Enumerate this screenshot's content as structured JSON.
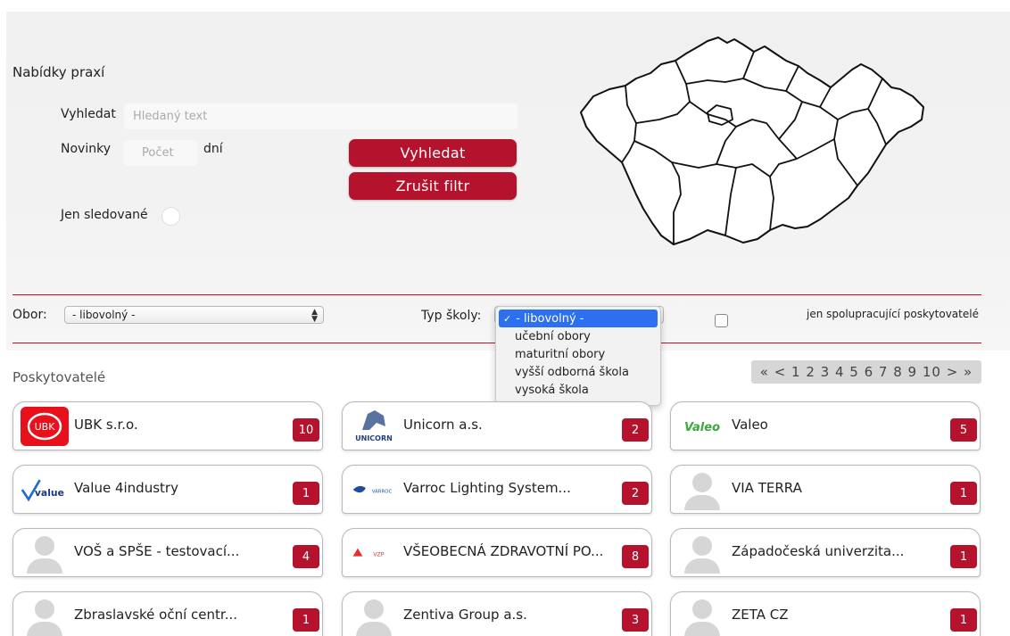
{
  "header": {
    "title": "Nabídky praxí"
  },
  "search": {
    "label": "Vyhledat",
    "placeholder": "Hledaný text",
    "news_label": "Novinky",
    "news_placeholder": "Počet",
    "news_unit": "dní",
    "search_button": "Vyhledat",
    "clear_button": "Zrušit filtr",
    "watched_label": "Jen sledované"
  },
  "filters": {
    "field_label": "Obor:",
    "field_value": "- libovolný -",
    "school_type_label": "Typ školy:",
    "school_type_options": [
      "- libovolný -",
      "učební obory",
      "maturitní obory",
      "vyšší odborná škola",
      "vysoká škola"
    ],
    "school_type_selected": "- libovolný -",
    "cooperating_label": "jen spolupracující poskytovatelé"
  },
  "providers": {
    "title": "Poskytovatelé",
    "pager": "« < 1 2 3 4 5 6 7 8 9 10 > »",
    "items": [
      {
        "name": "UBK s.r.o.",
        "count": "10",
        "logo": "ubk-logo"
      },
      {
        "name": "Unicorn a.s.",
        "count": "2",
        "logo": "unicorn-logo"
      },
      {
        "name": "Valeo",
        "count": "5",
        "logo": "valeo-logo"
      },
      {
        "name": "Value 4industry",
        "count": "1",
        "logo": "value-logo"
      },
      {
        "name": "Varroc Lighting System...",
        "count": "2",
        "logo": "varroc-logo"
      },
      {
        "name": "VIA TERRA",
        "count": "1",
        "logo": "avatar-icon"
      },
      {
        "name": "VOŠ a SPŠE - testovací...",
        "count": "4",
        "logo": "avatar-icon"
      },
      {
        "name": "VŠEOBECNÁ ZDRAVOTNÍ PO...",
        "count": "8",
        "logo": "vzp-logo"
      },
      {
        "name": "Západočeská univerzita...",
        "count": "1",
        "logo": "avatar-icon"
      },
      {
        "name": "Zbraslavské oční centr...",
        "count": "1",
        "logo": "avatar-icon"
      },
      {
        "name": "Zentiva Group a.s.",
        "count": "3",
        "logo": "avatar-icon"
      },
      {
        "name": "ZETA CZ",
        "count": "1",
        "logo": "avatar-icon"
      }
    ]
  },
  "logos": {
    "ubk": "UBK",
    "unicorn": "UNICORN",
    "valeo": "Valeo",
    "value": "value",
    "varroc": "VARROC",
    "vzp": "VZP"
  },
  "colors": {
    "accent": "#b5122d",
    "select_highlight": "#2c6ff0",
    "panel": "#f1f1f1"
  }
}
